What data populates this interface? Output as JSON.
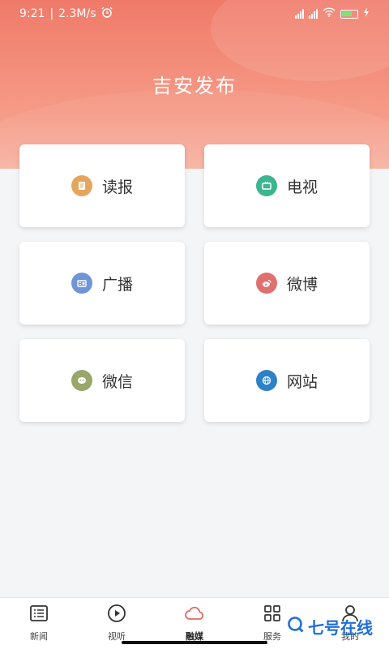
{
  "status_bar": {
    "time": "9:21",
    "speed": "2.3M/s",
    "alarm_icon": "alarm-icon",
    "battery_color": "#7ee37a"
  },
  "header": {
    "title": "吉安发布",
    "gradient_top": "#f07a69",
    "gradient_bottom": "#f7b3a2"
  },
  "cards": [
    {
      "label": "读报",
      "icon": "newspaper-icon",
      "color": "#e6a55d"
    },
    {
      "label": "电视",
      "icon": "tv-icon",
      "color": "#3db58e"
    },
    {
      "label": "广播",
      "icon": "radio-icon",
      "color": "#6f95d8"
    },
    {
      "label": "微博",
      "icon": "weibo-icon",
      "color": "#e0706e"
    },
    {
      "label": "微信",
      "icon": "wechat-icon",
      "color": "#9aa66a"
    },
    {
      "label": "网站",
      "icon": "globe-icon",
      "color": "#2e80c8"
    }
  ],
  "bottom_nav": {
    "items": [
      {
        "label": "新闻",
        "icon": "news-list-icon"
      },
      {
        "label": "视听",
        "icon": "play-icon"
      },
      {
        "label": "融媒",
        "icon": "cloud-icon",
        "active": true
      },
      {
        "label": "服务",
        "icon": "grid-apps-icon"
      },
      {
        "label": "我的",
        "icon": "user-icon"
      }
    ]
  },
  "watermark": {
    "text": "七号在线",
    "color": "#1e6fd9"
  }
}
